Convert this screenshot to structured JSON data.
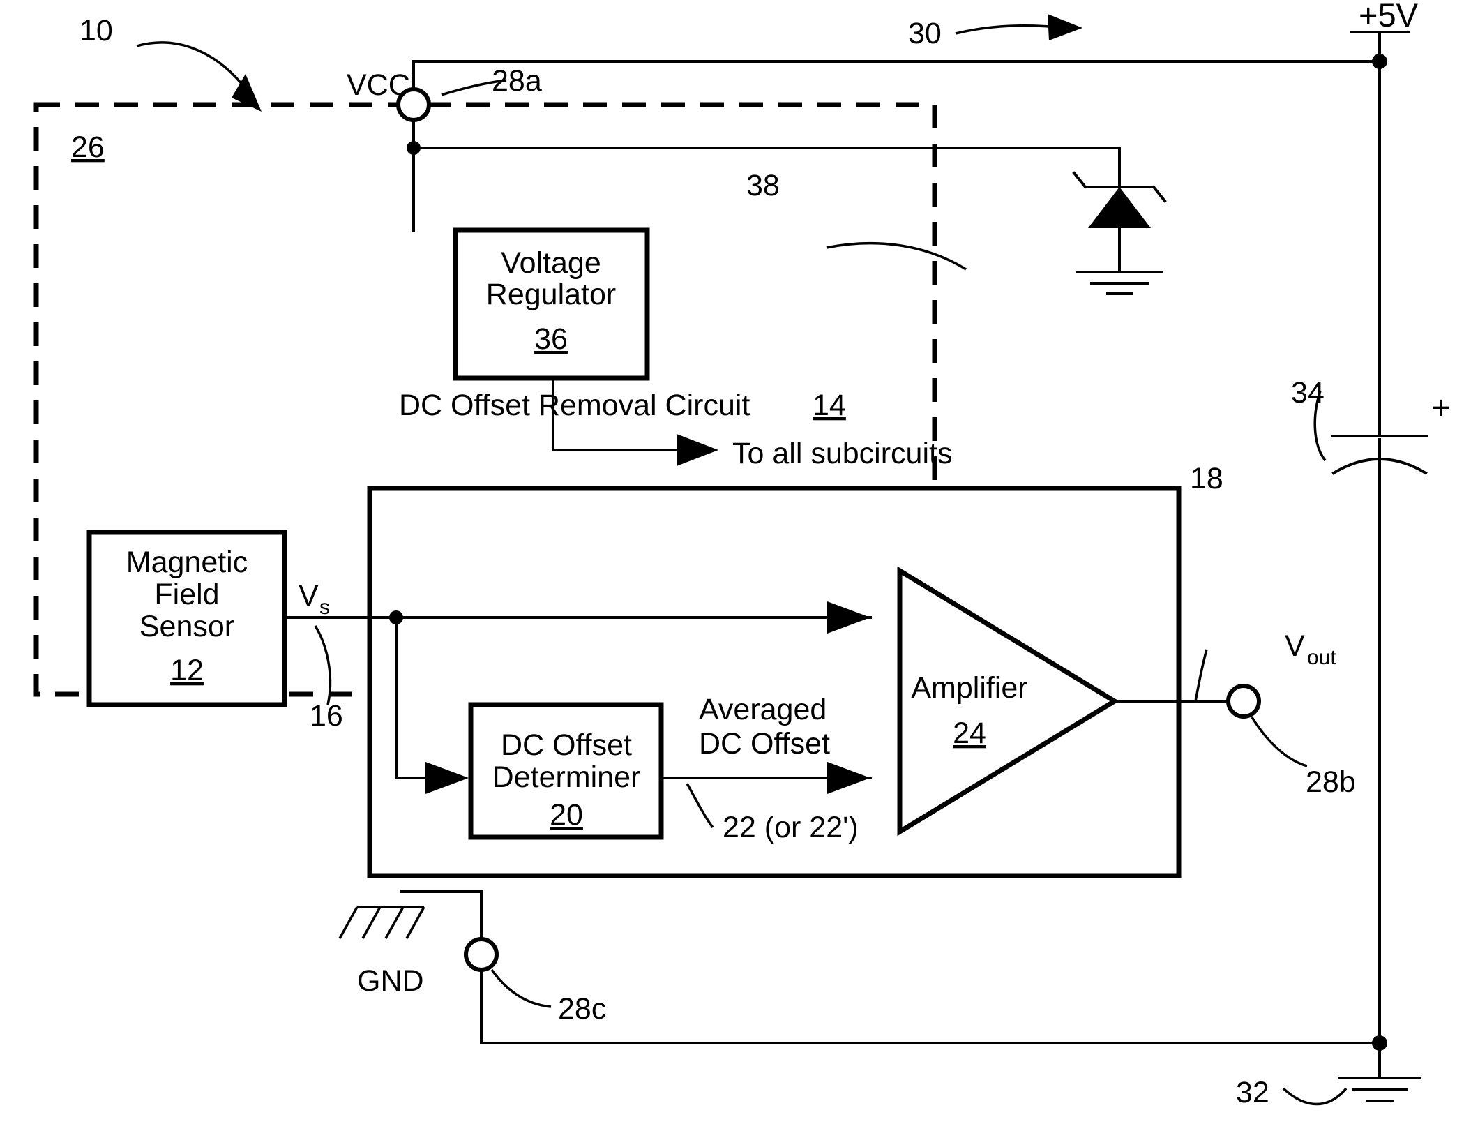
{
  "figure": {
    "assembly_ref": "10",
    "ic_boundary_ref": "26"
  },
  "supply": {
    "rail_label": "+5V",
    "rail_ref": "30",
    "capacitor_ref": "34",
    "capacitor_polarity": "+",
    "ground_ref": "32",
    "zener_ref": "38"
  },
  "pins": {
    "vcc_label": "VCC",
    "vcc_ref": "28a",
    "vout_label": "V",
    "vout_sub": "out",
    "vout_ref": "28b",
    "vout_net_ref": "18",
    "gnd_label": "GND",
    "gnd_ref": "28c"
  },
  "blocks": {
    "voltage_regulator": {
      "line1": "Voltage",
      "line2": "Regulator",
      "ref": "36"
    },
    "magnetic_field_sensor": {
      "line1": "Magnetic",
      "line2": "Field",
      "line3": "Sensor",
      "ref": "12"
    },
    "dc_offset_removal_circuit": {
      "title": "DC Offset Removal Circuit",
      "ref": "14"
    },
    "dc_offset_determiner": {
      "line1": "DC Offset",
      "line2": "Determiner",
      "ref": "20"
    },
    "amplifier": {
      "label": "Amplifier",
      "ref": "24"
    }
  },
  "signals": {
    "regulator_output": "To all subcircuits",
    "sensor_output_label": "V",
    "sensor_output_sub": "s",
    "sensor_output_ref": "16",
    "averaged_line1": "Averaged",
    "averaged_line2": "DC Offset",
    "averaged_ref": "22 (or 22')"
  },
  "colors": {
    "ink": "#000000",
    "paper": "#ffffff"
  }
}
